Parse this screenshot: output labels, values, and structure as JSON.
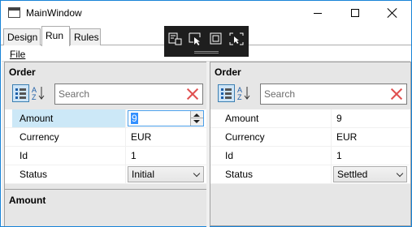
{
  "window": {
    "title": "MainWindow"
  },
  "tabs": [
    {
      "label": "Design"
    },
    {
      "label": "Run",
      "selected": true
    },
    {
      "label": "Rules"
    }
  ],
  "menu": {
    "file": "File"
  },
  "debug_toolbar": {
    "icons": [
      "select-element-icon",
      "track-focus-icon",
      "display-layout-adorners-icon",
      "hot-reload-icon"
    ]
  },
  "left_pane": {
    "title": "Order",
    "search_placeholder": "Search",
    "rows": [
      {
        "name": "Amount",
        "value": "9",
        "editor": "numeric",
        "selected": true
      },
      {
        "name": "Currency",
        "value": "EUR"
      },
      {
        "name": "Id",
        "value": "1"
      },
      {
        "name": "Status",
        "value": "Initial",
        "editor": "combo"
      }
    ],
    "description_title": "Amount"
  },
  "right_pane": {
    "title": "Order",
    "search_placeholder": "Search",
    "rows": [
      {
        "name": "Amount",
        "value": "9"
      },
      {
        "name": "Currency",
        "value": "EUR"
      },
      {
        "name": "Id",
        "value": "1"
      },
      {
        "name": "Status",
        "value": "Settled",
        "editor": "combo"
      }
    ]
  },
  "colors": {
    "accent": "#1883d7",
    "selection": "#cce8f7",
    "clear_icon": "#e05050",
    "toolbar_bg": "#1e1e1e"
  }
}
